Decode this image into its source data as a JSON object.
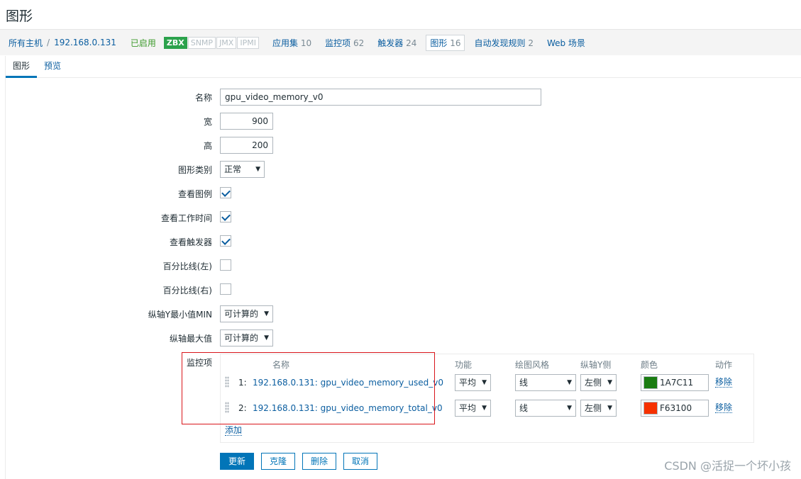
{
  "page": {
    "title": "图形"
  },
  "hostnav": {
    "all_hosts": "所有主机",
    "separator": "/",
    "host": "192.168.0.131",
    "status": "已启用",
    "availability": [
      "ZBX",
      "SNMP",
      "JMX",
      "IPMI"
    ],
    "links": [
      {
        "label": "应用集",
        "count": "10"
      },
      {
        "label": "监控项",
        "count": "62"
      },
      {
        "label": "触发器",
        "count": "24"
      },
      {
        "label": "图形",
        "count": "16"
      },
      {
        "label": "自动发现规则",
        "count": "2"
      },
      {
        "label": "Web 场景",
        "count": ""
      }
    ]
  },
  "tabs": [
    "图形",
    "预览"
  ],
  "form": {
    "name_label": "名称",
    "name_value": "gpu_video_memory_v0",
    "width_label": "宽",
    "width_value": "900",
    "height_label": "高",
    "height_value": "200",
    "graph_type_label": "图形类别",
    "graph_type_value": "正常",
    "show_legend_label": "查看图例",
    "show_legend": true,
    "show_working_time_label": "查看工作时间",
    "show_working_time": true,
    "show_triggers_label": "查看触发器",
    "show_triggers": true,
    "percentile_left_label": "百分比线(左)",
    "percentile_left": false,
    "percentile_right_label": "百分比线(右)",
    "percentile_right": false,
    "ymin_label": "纵轴Y最小值MIN",
    "ymin_value": "可计算的",
    "ymax_label": "纵轴最大值",
    "ymax_value": "可计算的"
  },
  "items": {
    "section_label": "监控项",
    "headers": {
      "name": "名称",
      "function": "功能",
      "draw_style": "绘图风格",
      "y_axis": "纵轴Y侧",
      "color": "颜色",
      "action": "动作"
    },
    "rows": [
      {
        "num": "1:",
        "name": "192.168.0.131: gpu_video_memory_used_v0",
        "function": "平均",
        "draw_style": "线",
        "y_axis": "左侧",
        "color_hex": "#1A7C11",
        "color": "1A7C11",
        "remove": "移除"
      },
      {
        "num": "2:",
        "name": "192.168.0.131: gpu_video_memory_total_v0",
        "function": "平均",
        "draw_style": "线",
        "y_axis": "左侧",
        "color_hex": "#F63100",
        "color": "F63100",
        "remove": "移除"
      }
    ],
    "add": "添加"
  },
  "buttons": {
    "update": "更新",
    "clone": "克隆",
    "delete": "删除",
    "cancel": "取消"
  },
  "watermark": "CSDN @活捉一个坏小孩"
}
